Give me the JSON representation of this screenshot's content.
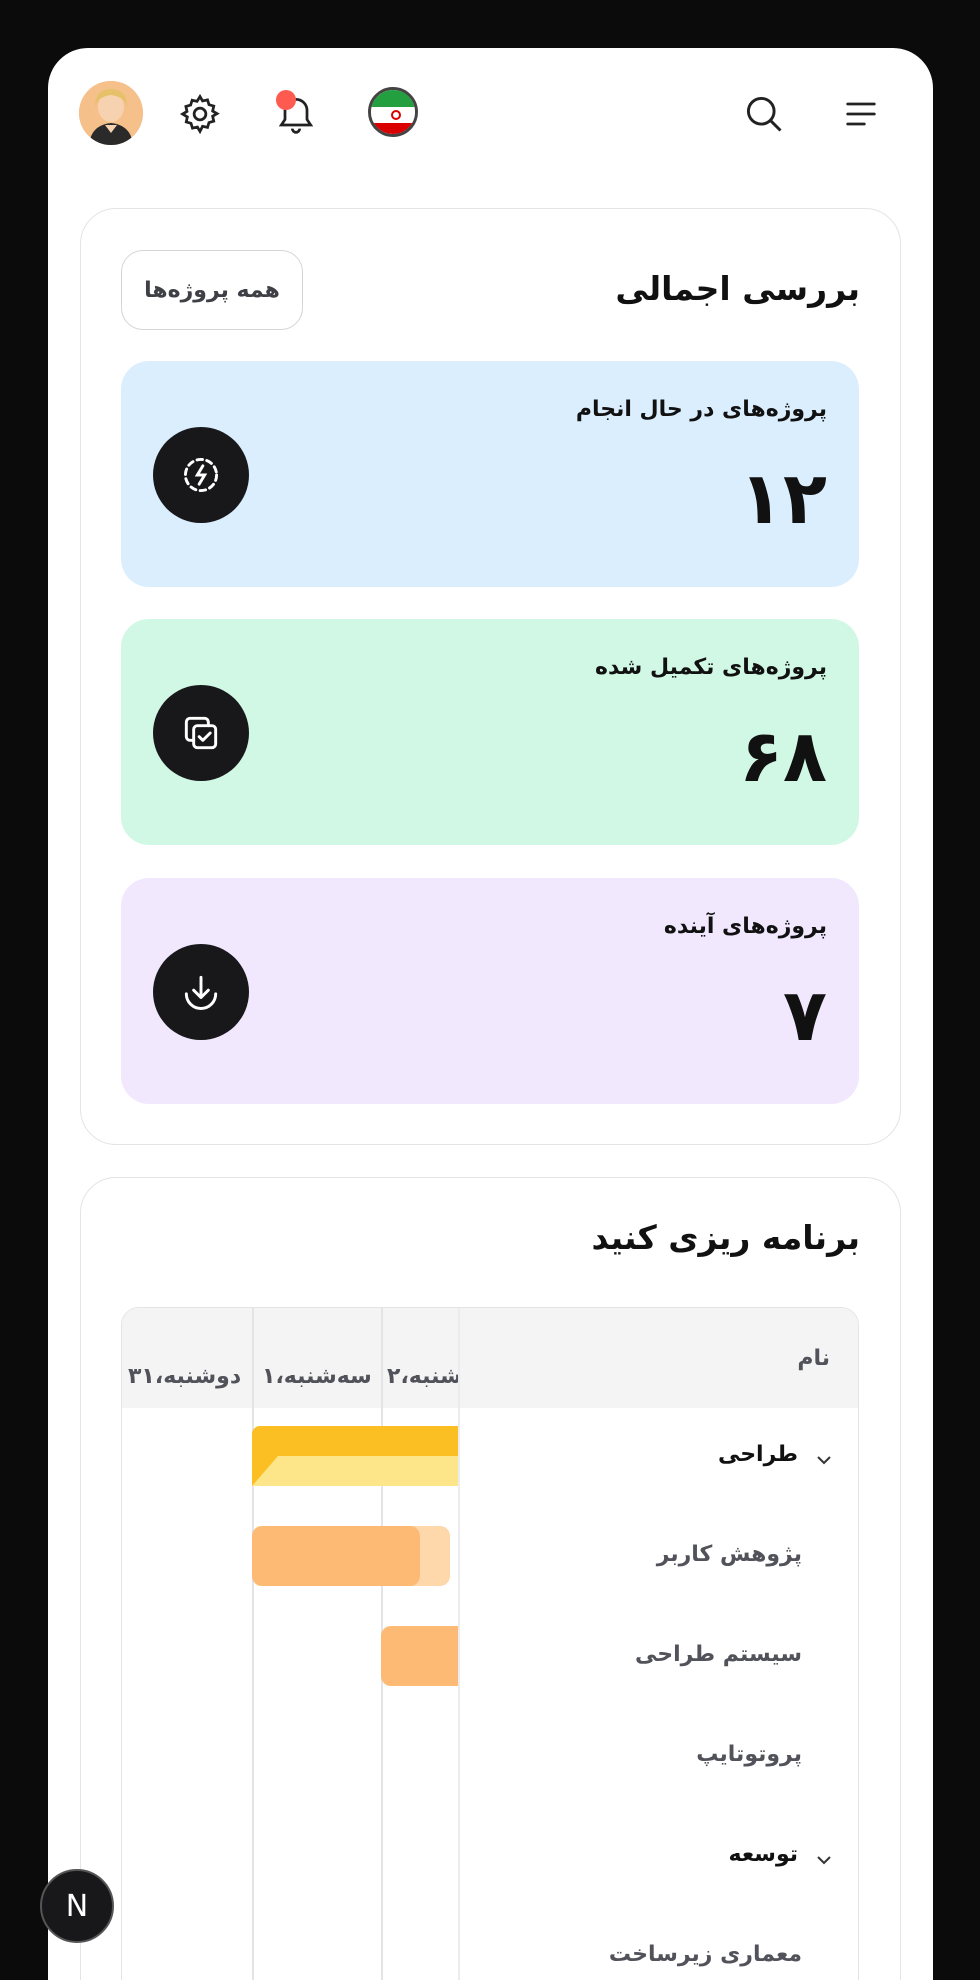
{
  "overview": {
    "title": "بررسی اجمالی",
    "all_projects_button": "همه پروژه‌ها",
    "stats": [
      {
        "label": "پروژه‌های در حال انجام",
        "value": "۱۲",
        "color": "#dbeefe",
        "icon": "lightning-icon"
      },
      {
        "label": "پروژه‌های تکمیل شده",
        "value": "۶۸",
        "color": "#d1f7e5",
        "icon": "copy-check-icon"
      },
      {
        "label": "پروژه‌های آینده",
        "value": "۷",
        "color": "#f1e8fe",
        "icon": "download-icon"
      }
    ]
  },
  "schedule": {
    "title": "برنامه ریزی کنید",
    "name_header": "نام",
    "day_columns": [
      "دوشنبه،۳۱",
      "سه‌شنبه،۱",
      "شنبه،۲"
    ],
    "rows": [
      {
        "label": "طراحی",
        "kind": "group",
        "expanded": true
      },
      {
        "label": "پژوهش کاربر",
        "kind": "task"
      },
      {
        "label": "سیستم طراحی",
        "kind": "task"
      },
      {
        "label": "پروتوتایپ",
        "kind": "task"
      },
      {
        "label": "توسعه",
        "kind": "group",
        "expanded": true
      },
      {
        "label": "معماری زیرساخت",
        "kind": "task"
      }
    ]
  },
  "colors": {
    "accent_yellow": "#fbbf24",
    "accent_yellow_light": "#fde68a",
    "accent_orange": "#fdba74",
    "accent_orange_light": "#fed7aa",
    "notification_dot": "#ff5a4f"
  },
  "fab": {
    "label": "N"
  }
}
